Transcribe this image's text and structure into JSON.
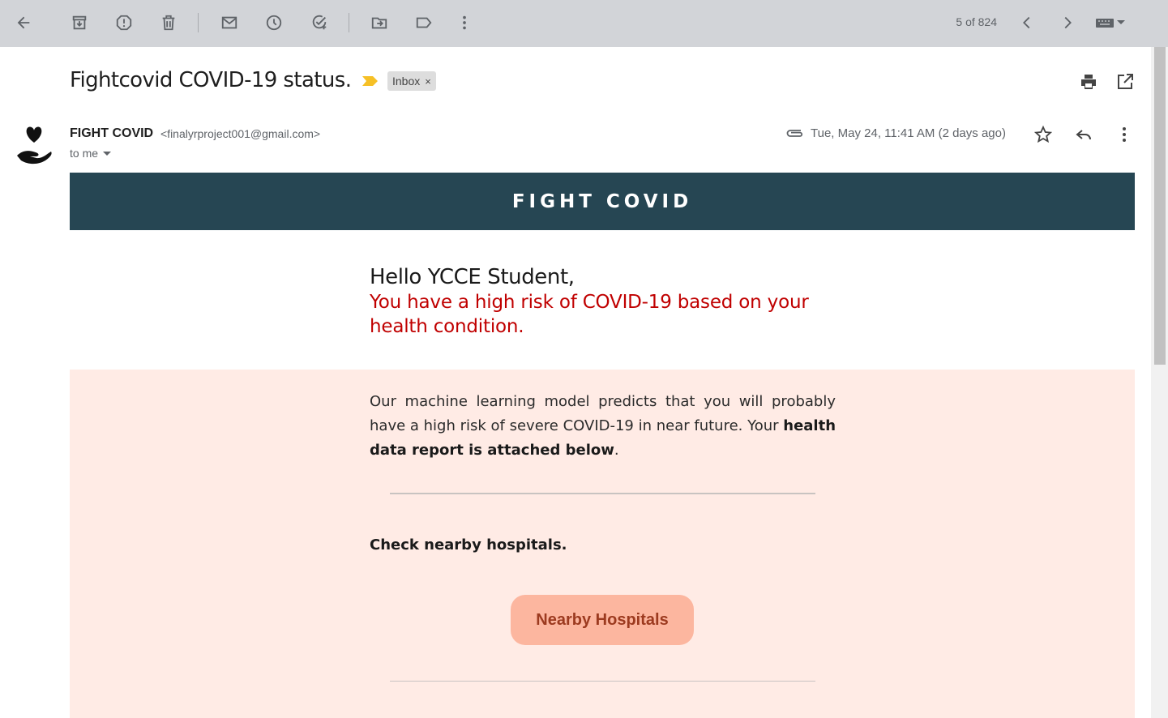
{
  "toolbar": {
    "icons": [
      "back-arrow-icon",
      "archive-icon",
      "report-spam-icon",
      "delete-icon",
      "mark-unread-icon",
      "snooze-icon",
      "add-task-icon",
      "move-to-icon",
      "label-icon",
      "more-vert-icon"
    ],
    "pager": "5 of 824",
    "prev_icon": "chevron-left-icon",
    "next_icon": "chevron-right-icon",
    "keyboard_icon": "keyboard-icon"
  },
  "email": {
    "subject": "Fightcovid COVID-19 status.",
    "label": "Inbox",
    "label_remove": "×",
    "sender_name": "FIGHT COVID",
    "sender_email": "<finalyrproject001@gmail.com>",
    "to": "to me",
    "date": "Tue, May 24, 11:41 AM (2 days ago)"
  },
  "body": {
    "banner": "FIGHT COVID",
    "greeting": "Hello YCCE Student,",
    "risk_message": "You have a high risk of COVID-19 based on your health condition.",
    "paragraph_plain": "Our machine learning model predicts that you will probably have a high risk of severe COVID-19 in near future. Your ",
    "paragraph_bold": "health data report is attached below",
    "paragraph_end": ".",
    "check_text": "Check nearby hospitals.",
    "button_label": "Nearby Hospitals"
  },
  "colors": {
    "banner_bg": "#264653",
    "risk_text": "#c00000",
    "content_bg": "#ffebe5",
    "button_bg": "#fcb69f",
    "button_text": "#9c3a1f",
    "important_marker": "#f6c026"
  }
}
